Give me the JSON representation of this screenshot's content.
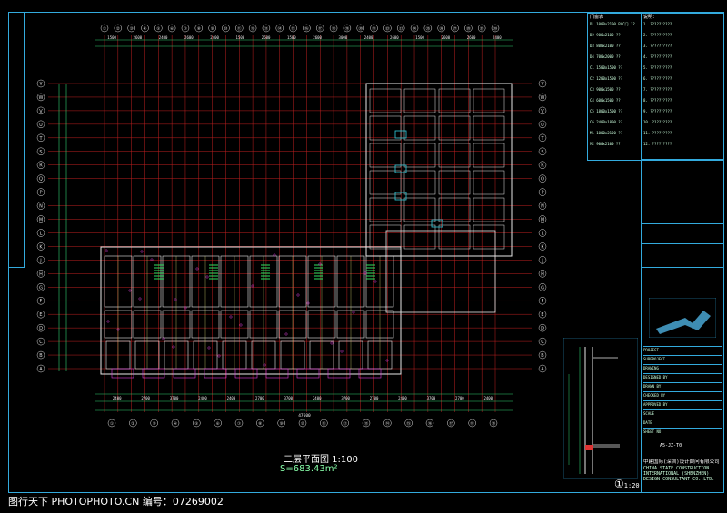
{
  "drawing": {
    "title": "二层平面图 1:100",
    "area": "S=683.43m²",
    "total_dimension": "47600",
    "detail_label": "1:20",
    "detail_marker": "①"
  },
  "watermark": "图行天下 PHOTOPHOTO.CN   编号：07269002",
  "grid_top_labels": [
    "①",
    "②",
    "③",
    "④",
    "⑤",
    "⑥",
    "⑦",
    "⑧",
    "⑨",
    "⑩",
    "⑪",
    "⑫",
    "⑬",
    "⑭",
    "⑮",
    "⑯",
    "⑰",
    "⑱",
    "⑲",
    "⑳",
    "㉑",
    "㉒",
    "㉓",
    "㉔",
    "㉕",
    "㉖",
    "㉗",
    "㉘",
    "㉙",
    "㉚"
  ],
  "grid_bottom_labels": [
    "①",
    "②",
    "③",
    "④",
    "⑤",
    "⑥",
    "⑦",
    "⑧",
    "⑨",
    "⑩",
    "⑪",
    "⑫",
    "⑬",
    "⑭",
    "⑮",
    "⑯",
    "⑰",
    "⑱",
    "⑲"
  ],
  "grid_left_labels": [
    "Y",
    "W",
    "V",
    "U",
    "T",
    "S",
    "R",
    "Q",
    "P",
    "N",
    "M",
    "L",
    "K",
    "J",
    "H",
    "G",
    "F",
    "E",
    "D",
    "C",
    "B",
    "A"
  ],
  "top_dimensions": [
    "1500",
    "2600",
    "2400",
    "2600",
    "2400",
    "1500",
    "2600",
    "1500",
    "2600",
    "3000",
    "2400",
    "2600",
    "1500",
    "2600",
    "2600",
    "2400"
  ],
  "bottom_dimensions": [
    "2400",
    "2700",
    "3700",
    "2400",
    "2400",
    "2700",
    "3700",
    "2400",
    "3700",
    "2700",
    "2400",
    "3700",
    "2700",
    "2400"
  ],
  "notes_panel": {
    "header": "门窗表",
    "rows": [
      "D1 1000x2100 PVC门 ??",
      "D2 900x2100 ??",
      "D3 800x2100 ??",
      "D4 700x2000 ??",
      "C1 1500x1500 ??",
      "C2 1200x1500 ??",
      "C3 900x1500 ??",
      "C4 600x1500 ??",
      "C5 1800x1500 ??",
      "C6 2400x1800 ??",
      "M1 1000x2100 ??",
      "M2 900x2100 ??"
    ]
  },
  "legend_panel": {
    "header": "说明：",
    "rows": [
      "1. ??????????",
      "2. ??????????",
      "3. ??????????",
      "4. ??????????",
      "5. ??????????",
      "6. ??????????",
      "7. ??????????",
      "8. ??????????",
      "9. ??????????",
      "10. ?????????",
      "11. ?????????",
      "12. ?????????"
    ]
  },
  "title_block": {
    "company_cn": "中建国际(深圳)设计顾问有限公司",
    "company_en_1": "CHINA STATE CONSTRUCTION",
    "company_en_2": "INTERNATIONAL (SHENZHEN)",
    "company_en_3": "DESIGN CONSULTANT CO.,LTD.",
    "fields": [
      "PROJECT",
      "SUBPROJECT",
      "DRAWING",
      "DESIGNED BY",
      "DRAWN BY",
      "CHECKED BY",
      "APPROVED BY",
      "SCALE",
      "DATE",
      "SHEET NO."
    ],
    "sheet_no": "A5-JZ-T0"
  },
  "colors": {
    "frame": "#33aadd",
    "grid": "#c02020",
    "wall": "#e8e8e8",
    "dimension": "#2fd070",
    "axis_circle": "#e0e0e0"
  }
}
